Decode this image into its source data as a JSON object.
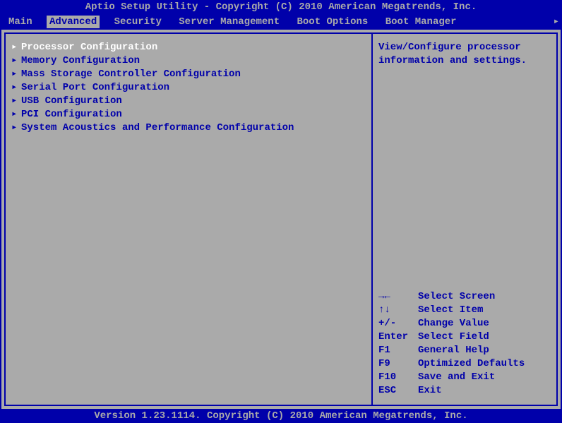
{
  "title": "Aptio Setup Utility - Copyright (C) 2010 American Megatrends, Inc.",
  "tabs": [
    {
      "label": "Main",
      "active": false
    },
    {
      "label": "Advanced",
      "active": true
    },
    {
      "label": "Security",
      "active": false
    },
    {
      "label": "Server Management",
      "active": false
    },
    {
      "label": "Boot Options",
      "active": false
    },
    {
      "label": "Boot Manager",
      "active": false
    }
  ],
  "menu_items": [
    {
      "label": "Processor Configuration",
      "selected": true
    },
    {
      "label": "Memory Configuration",
      "selected": false
    },
    {
      "label": "Mass Storage Controller Configuration",
      "selected": false
    },
    {
      "label": "Serial Port Configuration",
      "selected": false
    },
    {
      "label": "USB Configuration",
      "selected": false
    },
    {
      "label": "PCI Configuration",
      "selected": false
    },
    {
      "label": "System Acoustics and Performance Configuration",
      "selected": false
    }
  ],
  "help_text_line1": "View/Configure processor",
  "help_text_line2": "information and settings.",
  "key_hints": [
    {
      "key": "→←",
      "action": "Select Screen"
    },
    {
      "key": "↑↓",
      "action": "Select Item"
    },
    {
      "key": "+/-",
      "action": "Change Value"
    },
    {
      "key": "Enter",
      "action": "Select Field"
    },
    {
      "key": "F1",
      "action": "General Help"
    },
    {
      "key": "F9",
      "action": "Optimized Defaults"
    },
    {
      "key": "F10",
      "action": "Save and Exit"
    },
    {
      "key": "ESC",
      "action": "Exit"
    }
  ],
  "footer": "Version 1.23.1114. Copyright (C) 2010 American Megatrends, Inc.",
  "arrow_glyph": "▸",
  "tab_scroll_glyph": "▸"
}
